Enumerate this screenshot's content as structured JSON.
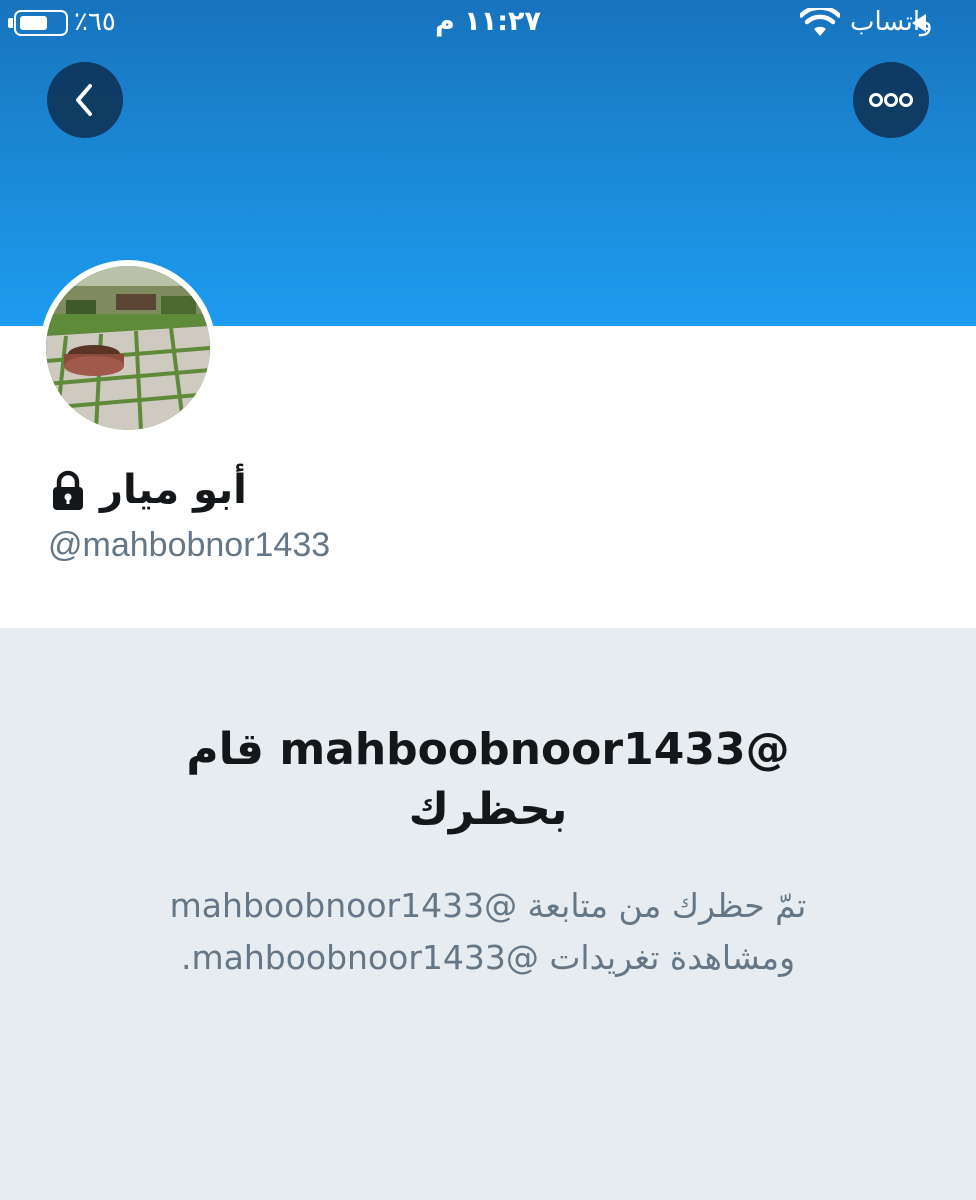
{
  "status_bar": {
    "battery_percent": "٪٦٥",
    "battery_level": 0.65,
    "time": "١١:٢٧ م",
    "carrier": "واتساب"
  },
  "header": {
    "back_icon": "chevron-left-icon",
    "more_icon": "more-horizontal-icon",
    "banner_color": "#1d9bf0"
  },
  "profile": {
    "display_name": "أبو ميار",
    "protected_icon": "lock-icon",
    "handle": "@mahbobnor1433"
  },
  "blocked_notice": {
    "title": "@mahboobnoor1433 قام بحظرك",
    "description": "تمّ حظرك من متابعة @mahboobnoor1433 ومشاهدة تغريدات @mahboobnoor1433."
  },
  "colors": {
    "text_primary": "#14171a",
    "text_secondary": "#657786",
    "background_gray": "#e6ecf0",
    "button_dark": "#0c3254"
  }
}
